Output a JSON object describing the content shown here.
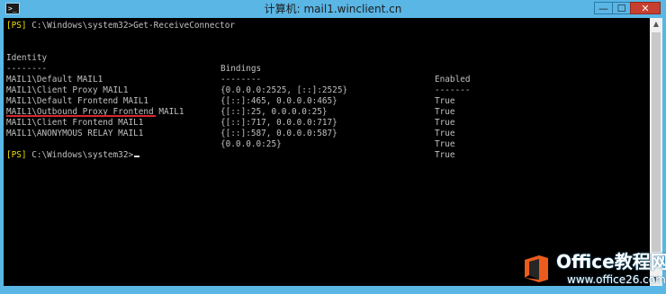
{
  "window": {
    "title": "计算机: mail1.winclient.cn",
    "controls": {
      "minimize": "—",
      "maximize": "☐",
      "close": "✕"
    }
  },
  "console": {
    "command_line": {
      "prompt_tag": "[PS]",
      "path": " C:\\Windows\\system32>",
      "command": "Get-ReceiveConnector"
    },
    "table": {
      "headers": {
        "identity": "Identity",
        "bindings": "Bindings",
        "enabled": "Enabled"
      },
      "separators": {
        "identity": "--------",
        "bindings": "--------",
        "enabled": "-------"
      },
      "rows": [
        {
          "identity": "MAIL1\\Default MAIL1",
          "bindings": "{0.0.0.0:2525, [::]:2525}",
          "enabled": "True"
        },
        {
          "identity": "MAIL1\\Client Proxy MAIL1",
          "bindings": "{[::]:465, 0.0.0.0:465}",
          "enabled": "True"
        },
        {
          "identity": "MAIL1\\Default Frontend MAIL1",
          "bindings": "{[::]:25, 0.0.0.0:25}",
          "enabled": "True"
        },
        {
          "identity": "MAIL1\\Outbound Proxy Frontend MAIL1",
          "bindings": "{[::]:717, 0.0.0.0:717}",
          "enabled": "True"
        },
        {
          "identity": "MAIL1\\Client Frontend MAIL1",
          "bindings": "{[::]:587, 0.0.0.0:587}",
          "enabled": "True"
        },
        {
          "identity": "MAIL1\\ANONYMOUS RELAY MAIL1",
          "bindings": "{0.0.0.0:25}",
          "enabled": "True"
        }
      ]
    },
    "prompt_line": {
      "prompt_tag": "[PS]",
      "path": " C:\\Windows\\system32>"
    }
  },
  "watermark": {
    "main_text": "Office教程网",
    "sub_text": "www.office26.com"
  },
  "colors": {
    "console_bg": "#000000",
    "console_text": "#c0c0c0",
    "ps_tag": "#f0e000",
    "highlight_underline": "#d9262e",
    "titlebar": "#5ab6e5",
    "close_button": "#c7402f",
    "logo_orange": "#eb5b1e"
  }
}
